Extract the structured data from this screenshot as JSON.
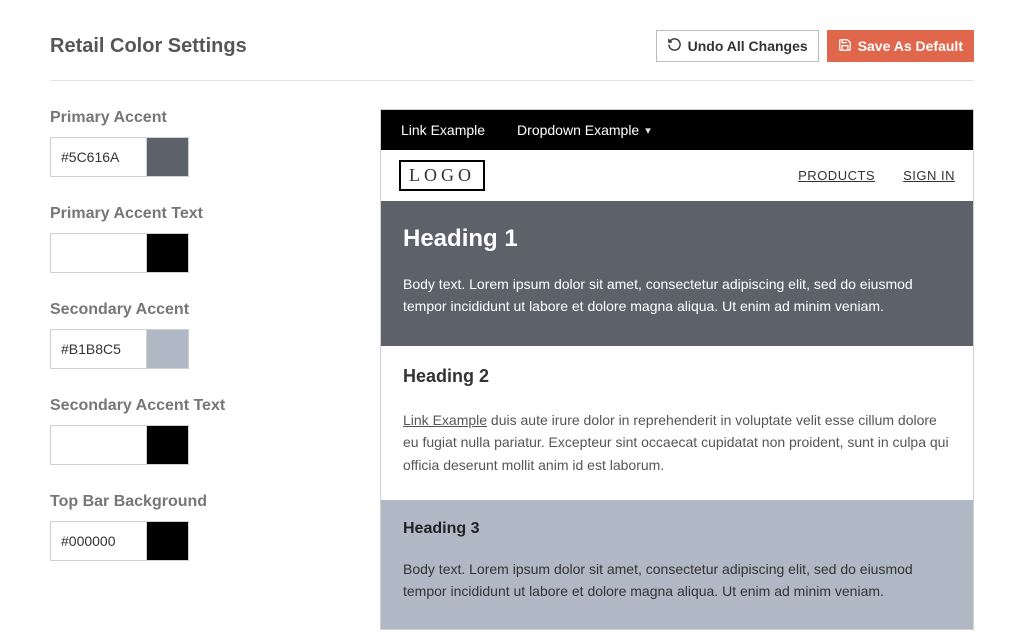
{
  "header": {
    "title": "Retail Color Settings",
    "undo_label": "Undo All Changes",
    "save_label": "Save As Default"
  },
  "colors": {
    "primary_accent": {
      "label": "Primary Accent",
      "value": "#5C616A",
      "swatch": "#5C616A"
    },
    "primary_accent_text": {
      "label": "Primary Accent Text",
      "value": "",
      "swatch": "#000000"
    },
    "secondary_accent": {
      "label": "Secondary Accent",
      "value": "#B1B8C5",
      "swatch": "#B1B8C5"
    },
    "secondary_accent_text": {
      "label": "Secondary Accent Text",
      "value": "",
      "swatch": "#000000"
    },
    "topbar_bg": {
      "label": "Top Bar Background",
      "value": "#000000",
      "swatch": "#000000"
    }
  },
  "preview": {
    "topbar": {
      "link_label": "Link Example",
      "dropdown_label": "Dropdown Example"
    },
    "logo": "LOGO",
    "nav": {
      "products": "PRODUCTS",
      "signin": "SIGN IN"
    },
    "hero": {
      "heading": "Heading 1",
      "body": "Body text. Lorem ipsum dolor sit amet, consectetur adipiscing elit, sed do eiusmod tempor incididunt ut labore et dolore magna aliqua. Ut enim ad minim veniam."
    },
    "section2": {
      "heading": "Heading 2",
      "link": "Link Example",
      "body_rest": " duis aute irure dolor in reprehenderit in voluptate velit esse cillum dolore eu fugiat nulla pariatur. Excepteur sint occaecat cupidatat non proident, sunt in culpa qui officia deserunt mollit anim id est laborum."
    },
    "section3": {
      "heading": "Heading 3",
      "body": "Body text. Lorem ipsum dolor sit amet, consectetur adipiscing elit, sed do eiusmod tempor incididunt ut labore et dolore magna aliqua. Ut enim ad minim veniam."
    }
  }
}
